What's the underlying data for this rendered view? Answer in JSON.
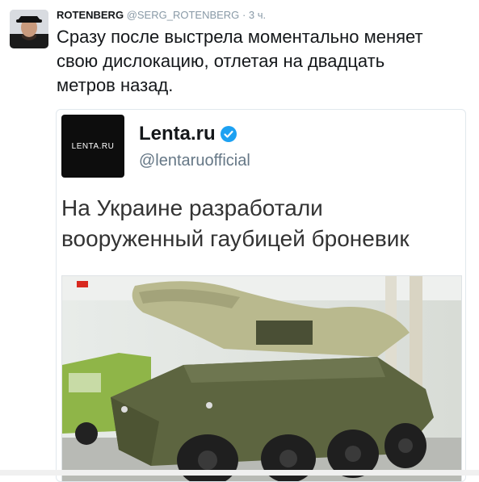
{
  "tweet": {
    "author_name": "ROTENBERG",
    "author_handle": "@SERG_ROTENBERG",
    "separator": "·",
    "time": "3 ч.",
    "text": "Сразу после выстрела моментально меняет свою дислокацию, отлетая на двадцать метров назад."
  },
  "embedded": {
    "logo_text": "LENTA.RU",
    "name": "Lenta.ru",
    "handle": "@lentaruofficial",
    "headline": "На Украине разработали вооруженный гаубицей броневик",
    "photo_icon": "armored-vehicle-photo"
  },
  "colors": {
    "verified": "#1da1f2",
    "vehicle": "#5d6540",
    "cover": "#b9b98e"
  }
}
